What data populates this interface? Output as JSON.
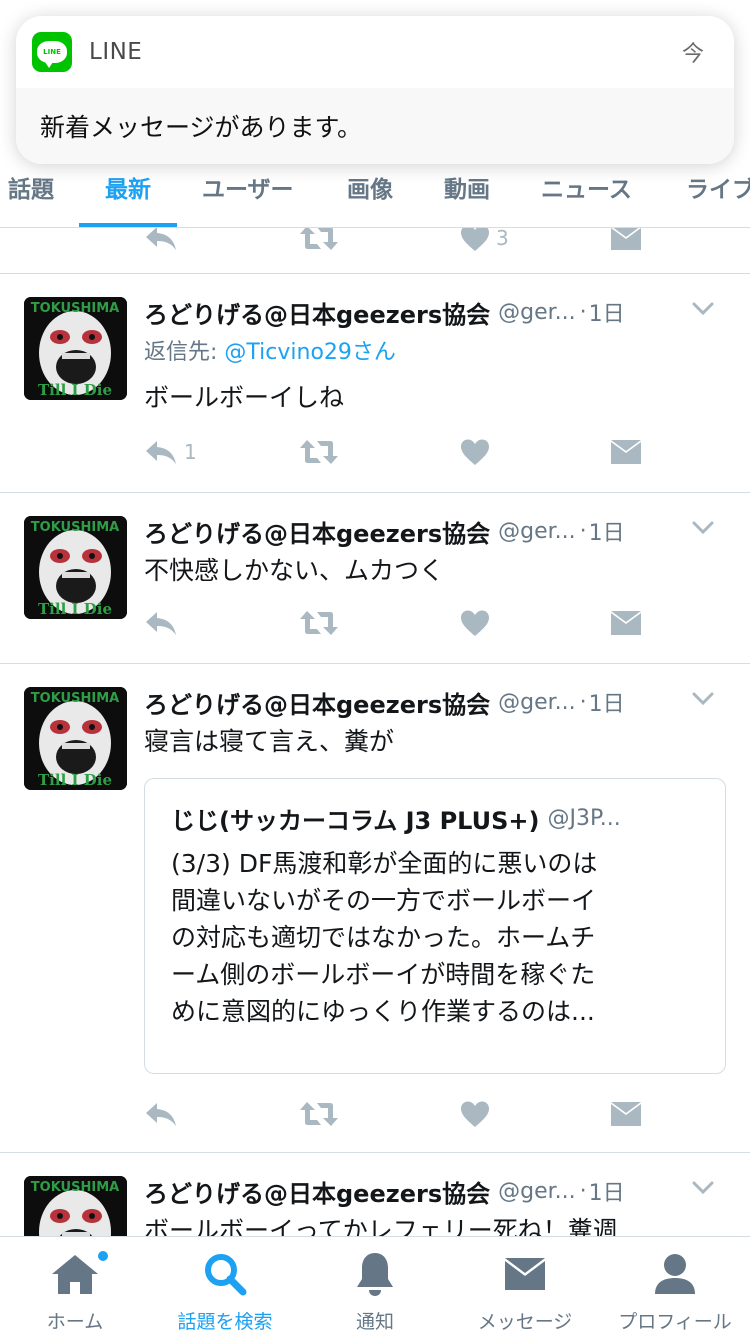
{
  "notification": {
    "app": "LINE",
    "time": "今",
    "message": "新着メッセージがあります。",
    "icon_text": "LINE"
  },
  "tabs": [
    {
      "label": "話題",
      "active": false
    },
    {
      "label": "最新",
      "active": true
    },
    {
      "label": "ユーザー",
      "active": false
    },
    {
      "label": "画像",
      "active": false
    },
    {
      "label": "動画",
      "active": false
    },
    {
      "label": "ニュース",
      "active": false
    },
    {
      "label": "ライブ",
      "active": false
    }
  ],
  "partial_top_tweet": {
    "like_count": "3"
  },
  "tweets": [
    {
      "name": "ろどりげる@日本geezers協会",
      "handle": "@ger...",
      "dot": "·",
      "time": "1日",
      "reply_prefix": "返信先: ",
      "reply_to": "@Ticvino29さん",
      "text": "ボールボーイしね",
      "reply_count": "1"
    },
    {
      "name": "ろどりげる@日本geezers協会",
      "handle": "@ger...",
      "dot": "·",
      "time": "1日",
      "text": "不快感しかない、ムカつく"
    },
    {
      "name": "ろどりげる@日本geezers協会",
      "handle": "@ger...",
      "dot": "·",
      "time": "1日",
      "text": "寝言は寝て言え、糞が",
      "quote": {
        "name": "じじ(サッカーコラム J3 PLUS+)",
        "handle": "@J3P...",
        "lines": [
          "(3/3) DF馬渡和彰が全面的に悪いのは",
          "間違いないがその一方でボールボーイ",
          "の対応も適切ではなかった。ホームチ",
          "ーム側のボールボーイが時間を稼ぐた",
          "めに意図的にゆっくり作業するのは..."
        ]
      }
    },
    {
      "name": "ろどりげる@日本geezers協会",
      "handle": "@ger...",
      "dot": "·",
      "time": "1日",
      "text": "ボールボーイってかレフェリー死ね！糞週"
    }
  ],
  "avatar_text": {
    "top": "TOKUSHIMA",
    "bottom": "Till I Die"
  },
  "bottom_nav": [
    {
      "label": "ホーム",
      "icon": "home-icon",
      "active": false
    },
    {
      "label": "話題を検索",
      "icon": "search-icon",
      "active": true
    },
    {
      "label": "通知",
      "icon": "bell-icon",
      "active": false
    },
    {
      "label": "メッセージ",
      "icon": "envelope-icon",
      "active": false
    },
    {
      "label": "プロフィール",
      "icon": "person-icon",
      "active": false
    }
  ],
  "colors": {
    "accent": "#1da1f2",
    "text": "#14171a",
    "secondary": "#657786",
    "icon_gray": "#aab8c2",
    "line_green": "#00c300"
  }
}
